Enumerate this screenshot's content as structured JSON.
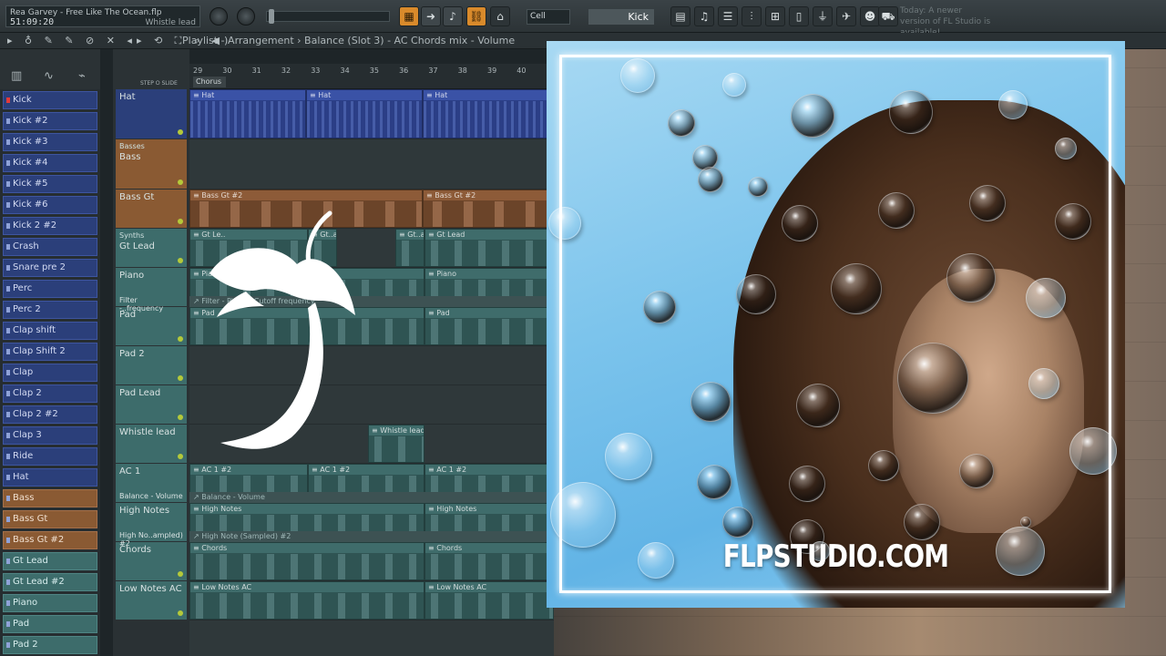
{
  "song": {
    "title": "Rea Garvey - Free Like The Ocean.flp",
    "time": "51:09:20",
    "channel": "Whistle lead"
  },
  "toolbar": {
    "snap": "Cell",
    "pattern": "Kick",
    "notice": "Today: A newer version of FL Studio is available!"
  },
  "breadcrumb": "Playlist - Arrangement  ›  Balance (Slot 3) - AC Chords mix - Volume",
  "step_slide": "STEP ⭘ SLIDE",
  "ruler": {
    "bars": [
      "29",
      "30",
      "31",
      "32",
      "33",
      "34",
      "35",
      "36",
      "37",
      "38",
      "39",
      "40"
    ],
    "marker": "Chorus"
  },
  "channels": [
    {
      "label": "Kick",
      "color": "blue",
      "red": true
    },
    {
      "label": "Kick #2",
      "color": "blue"
    },
    {
      "label": "Kick #3",
      "color": "blue"
    },
    {
      "label": "Kick #4",
      "color": "blue"
    },
    {
      "label": "Kick #5",
      "color": "blue"
    },
    {
      "label": "Kick #6",
      "color": "blue"
    },
    {
      "label": "Kick 2 #2",
      "color": "blue"
    },
    {
      "label": "Crash",
      "color": "blue"
    },
    {
      "label": "Snare pre 2",
      "color": "blue"
    },
    {
      "label": "Perc",
      "color": "blue"
    },
    {
      "label": "Perc 2",
      "color": "blue"
    },
    {
      "label": "Clap shift",
      "color": "blue"
    },
    {
      "label": "Clap Shift 2",
      "color": "blue"
    },
    {
      "label": "Clap",
      "color": "blue"
    },
    {
      "label": "Clap 2",
      "color": "blue"
    },
    {
      "label": "Clap 2 #2",
      "color": "blue"
    },
    {
      "label": "Clap 3",
      "color": "blue"
    },
    {
      "label": "Ride",
      "color": "blue"
    },
    {
      "label": "Hat",
      "color": "blue"
    },
    {
      "label": "Bass",
      "color": "brown"
    },
    {
      "label": "Bass Gt",
      "color": "brown"
    },
    {
      "label": "Bass Gt #2",
      "color": "brown"
    },
    {
      "label": "Gt Lead",
      "color": "teal"
    },
    {
      "label": "Gt Lead #2",
      "color": "teal"
    },
    {
      "label": "Piano",
      "color": "teal"
    },
    {
      "label": "Pad",
      "color": "teal"
    },
    {
      "label": "Pad 2",
      "color": "teal"
    }
  ],
  "tracks": [
    {
      "name": "Hat",
      "group": "",
      "color": "blue",
      "height": 55,
      "clips": [
        {
          "label": "Hat",
          "start": 0,
          "width": 128
        },
        {
          "label": "Hat",
          "start": 128,
          "width": 128
        },
        {
          "label": "Hat",
          "start": 256,
          "width": 144
        }
      ]
    },
    {
      "name": "Bass",
      "group": "Basses",
      "color": "brown",
      "height": 55,
      "clips": []
    },
    {
      "name": "Bass Gt",
      "group": "",
      "color": "brown",
      "height": 43,
      "clips": [
        {
          "label": "Bass Gt #2",
          "start": 0,
          "width": 256
        },
        {
          "label": "Bass Gt #2",
          "start": 256,
          "width": 144
        }
      ]
    },
    {
      "name": "Gt Lead",
      "group": "Synths",
      "color": "teal",
      "height": 43,
      "clips": [
        {
          "label": "Gt Le..",
          "start": 0,
          "width": 130
        },
        {
          "label": "Gt..ad",
          "start": 130,
          "width": 32
        },
        {
          "label": "Gt..ad",
          "start": 226,
          "width": 32
        },
        {
          "label": "Gt Lead",
          "start": 258,
          "width": 142
        }
      ]
    },
    {
      "name": "Piano",
      "group": "",
      "color": "teal",
      "height": 43,
      "clips": [
        {
          "label": "Piano",
          "start": 0,
          "width": 258
        },
        {
          "label": "Piano",
          "start": 258,
          "width": 142
        }
      ]
    },
    {
      "name": "Pad",
      "group": "",
      "color": "teal",
      "height": 43,
      "auto": "Filter - Piano - Cutoff frequency",
      "auto_track": "Filter -..frequency",
      "clips": [
        {
          "label": "Pad",
          "start": 0,
          "width": 258
        },
        {
          "label": "Pad",
          "start": 258,
          "width": 142
        }
      ]
    },
    {
      "name": "Pad 2",
      "group": "",
      "color": "teal",
      "height": 43,
      "clips": []
    },
    {
      "name": "Pad Lead",
      "group": "",
      "color": "teal",
      "height": 43,
      "clips": []
    },
    {
      "name": "Whistle lead",
      "group": "",
      "color": "teal",
      "height": 43,
      "clips": [
        {
          "label": "Whistle lead",
          "start": 196,
          "width": 62
        }
      ]
    },
    {
      "name": "AC 1",
      "group": "",
      "color": "teal",
      "height": 43,
      "clips": [
        {
          "label": "AC 1 #2",
          "start": 0,
          "width": 130
        },
        {
          "label": "AC 1 #2",
          "start": 130,
          "width": 128
        },
        {
          "label": "AC 1 #2",
          "start": 258,
          "width": 142
        }
      ]
    },
    {
      "name": "High Notes",
      "group": "",
      "color": "teal",
      "height": 43,
      "auto": "Balance - Volume",
      "auto_track": "Balance - Volume",
      "clips": [
        {
          "label": "High Notes",
          "start": 0,
          "width": 258
        },
        {
          "label": "High Notes",
          "start": 258,
          "width": 142
        }
      ]
    },
    {
      "name": "Chords",
      "group": "",
      "color": "teal",
      "height": 43,
      "auto": "High Note (Sampled) #2",
      "auto_track": "High No..ampled) #2",
      "clips": [
        {
          "label": "Chords",
          "start": 0,
          "width": 258
        },
        {
          "label": "Chords",
          "start": 258,
          "width": 142
        }
      ]
    },
    {
      "name": "Low Notes AC",
      "group": "",
      "color": "teal",
      "height": 43,
      "clips": [
        {
          "label": "Low Notes AC",
          "start": 0,
          "width": 258
        },
        {
          "label": "Low Notes AC",
          "start": 258,
          "width": 142
        }
      ]
    }
  ],
  "cover": {
    "site": "FLPSTUDIO.COM"
  },
  "colors": {
    "accent": "#d98a2b",
    "blue": "#2b3f7a",
    "brown": "#8a5a33",
    "teal": "#3d6c6b",
    "frame": "#ffffff"
  }
}
